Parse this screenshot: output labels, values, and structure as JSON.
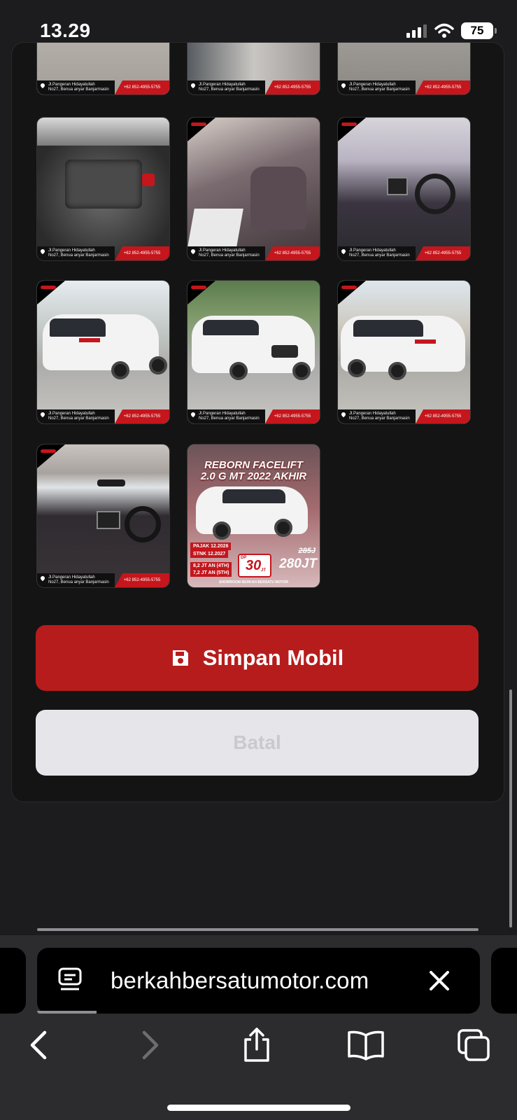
{
  "status_bar": {
    "time": "13.29",
    "battery": "75"
  },
  "gallery": {
    "address_line1": "Jl.Pangeran Hidayatullah",
    "address_line2": "No27, Benua anyar Banjarmasin",
    "phone": "+62 852-4955-5755"
  },
  "promo": {
    "title_line1": "REBORN FACELIFT",
    "title_line2": "2.0 G MT 2022 AKHIR",
    "pajak": "PAJAK 12.2026",
    "stnk": "STNK 12.2027",
    "dp_label": "DP",
    "dp_value": "30",
    "dp_unit": "JT",
    "price_old": "285J",
    "price_new": "280JT",
    "credit1": "8,2 JT AN  (4TH)",
    "credit2": "7,2 JT AN  (5TH)",
    "showroom": "SHOWROOM BERKAH BERSATU MOTOR"
  },
  "actions": {
    "save_label": "Simpan Mobil",
    "cancel_label": "Batal"
  },
  "browser": {
    "url": "berkahbersatumotor.com"
  },
  "icons": {
    "save": "floppy-disk-icon",
    "reader": "reader-mode-icon",
    "clear": "close-icon",
    "back": "chevron-left-icon",
    "forward": "chevron-right-icon",
    "share": "share-icon",
    "bookmarks": "book-icon",
    "tabs": "tabs-icon"
  },
  "colors": {
    "accent": "#b71c1c",
    "brand_red": "#c4161c",
    "background": "#1c1c1e"
  }
}
